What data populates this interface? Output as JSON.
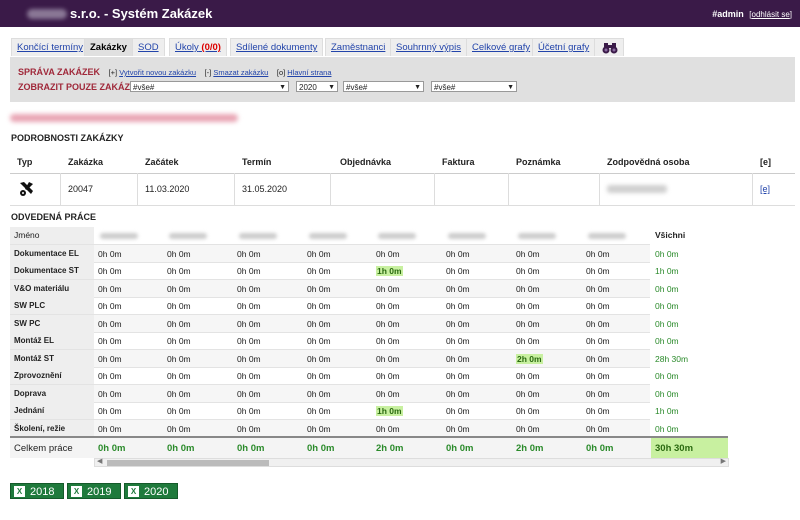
{
  "header": {
    "title": "s.r.o. - Systém Zakázek",
    "user": "#admin",
    "logout": "odhlásit se"
  },
  "tabs": [
    {
      "label": "Končící termíny"
    },
    {
      "label": "Zakázky"
    },
    {
      "label": "SOD"
    },
    {
      "label": "Úkoly",
      "badge": "(0/0)"
    },
    {
      "label": "Sdílené dokumenty"
    },
    {
      "label": "Zaměstnanci"
    },
    {
      "label": "Souhrnný výpis"
    },
    {
      "label": "Celkové grafy"
    },
    {
      "label": "Účetní grafy"
    }
  ],
  "panel": {
    "heading": "SPRÁVA ZAKÁZEK",
    "new_prefix": "[+]",
    "new_label": "Vytvořit novou zakázku",
    "del_prefix": "[-]",
    "del_label": "Smazat zakázku",
    "home_prefix": "[o]",
    "home_label": "Hlavní strana",
    "filter_label": "ZOBRAZIT POUZE ZAKÁZKY",
    "filter1": "#vše#",
    "year": "2020",
    "filter2": "#vše#",
    "filter3": "#vše#"
  },
  "details": {
    "title": "PODROBNOSTI ZAKÁZKY",
    "headers": [
      "Typ",
      "Zakázka",
      "Začátek",
      "Termín",
      "Objednávka",
      "Faktura",
      "Poznámka",
      "Zodpovědná osoba",
      "[e]"
    ],
    "zakazka": "20047",
    "zacatek": "11.03.2020",
    "termin": "31.05.2020",
    "edit": "[e]"
  },
  "work": {
    "title": "ODVEDENÁ PRÁCE",
    "name_header": "Jméno",
    "all_header": "Všichni",
    "rows": [
      {
        "name": "Dokumentace EL",
        "v": [
          "0h 0m",
          "0h 0m",
          "0h 0m",
          "0h 0m",
          "0h 0m",
          "0h 0m",
          "0h 0m",
          "0h 0m"
        ],
        "all": "0h 0m"
      },
      {
        "name": "Dokumentace ST",
        "v": [
          "0h 0m",
          "0h 0m",
          "0h 0m",
          "0h 0m",
          "1h 0m",
          "0h 0m",
          "0h 0m",
          "0h 0m"
        ],
        "all": "1h 0m"
      },
      {
        "name": "V&O materiálu",
        "v": [
          "0h 0m",
          "0h 0m",
          "0h 0m",
          "0h 0m",
          "0h 0m",
          "0h 0m",
          "0h 0m",
          "0h 0m"
        ],
        "all": "0h 0m"
      },
      {
        "name": "SW PLC",
        "v": [
          "0h 0m",
          "0h 0m",
          "0h 0m",
          "0h 0m",
          "0h 0m",
          "0h 0m",
          "0h 0m",
          "0h 0m"
        ],
        "all": "0h 0m"
      },
      {
        "name": "SW PC",
        "v": [
          "0h 0m",
          "0h 0m",
          "0h 0m",
          "0h 0m",
          "0h 0m",
          "0h 0m",
          "0h 0m",
          "0h 0m"
        ],
        "all": "0h 0m"
      },
      {
        "name": "Montáž EL",
        "v": [
          "0h 0m",
          "0h 0m",
          "0h 0m",
          "0h 0m",
          "0h 0m",
          "0h 0m",
          "0h 0m",
          "0h 0m"
        ],
        "all": "0h 0m"
      },
      {
        "name": "Montáž ST",
        "v": [
          "0h 0m",
          "0h 0m",
          "0h 0m",
          "0h 0m",
          "0h 0m",
          "0h 0m",
          "2h 0m",
          "0h 0m"
        ],
        "all": "28h 30m"
      },
      {
        "name": "Zprovoznění",
        "v": [
          "0h 0m",
          "0h 0m",
          "0h 0m",
          "0h 0m",
          "0h 0m",
          "0h 0m",
          "0h 0m",
          "0h 0m"
        ],
        "all": "0h 0m"
      },
      {
        "name": "Doprava",
        "v": [
          "0h 0m",
          "0h 0m",
          "0h 0m",
          "0h 0m",
          "0h 0m",
          "0h 0m",
          "0h 0m",
          "0h 0m"
        ],
        "all": "0h 0m"
      },
      {
        "name": "Jednání",
        "v": [
          "0h 0m",
          "0h 0m",
          "0h 0m",
          "0h 0m",
          "1h 0m",
          "0h 0m",
          "0h 0m",
          "0h 0m"
        ],
        "all": "1h 0m"
      },
      {
        "name": "Školení, režie",
        "v": [
          "0h 0m",
          "0h 0m",
          "0h 0m",
          "0h 0m",
          "0h 0m",
          "0h 0m",
          "0h 0m",
          "0h 0m"
        ],
        "all": "0h 0m"
      }
    ],
    "total_label": "Celkem práce",
    "totals": [
      "0h 0m",
      "0h 0m",
      "0h 0m",
      "0h 0m",
      "2h 0m",
      "0h 0m",
      "2h 0m",
      "0h 0m"
    ],
    "total_all": "30h 30m"
  },
  "exports": [
    {
      "year": "2018"
    },
    {
      "year": "2019"
    },
    {
      "year": "2020"
    }
  ],
  "colors": {
    "topbar": "#3a1a48",
    "accent_red": "#a0283a",
    "highlight": "#c8f0a0",
    "excel": "#1f7a3c"
  }
}
